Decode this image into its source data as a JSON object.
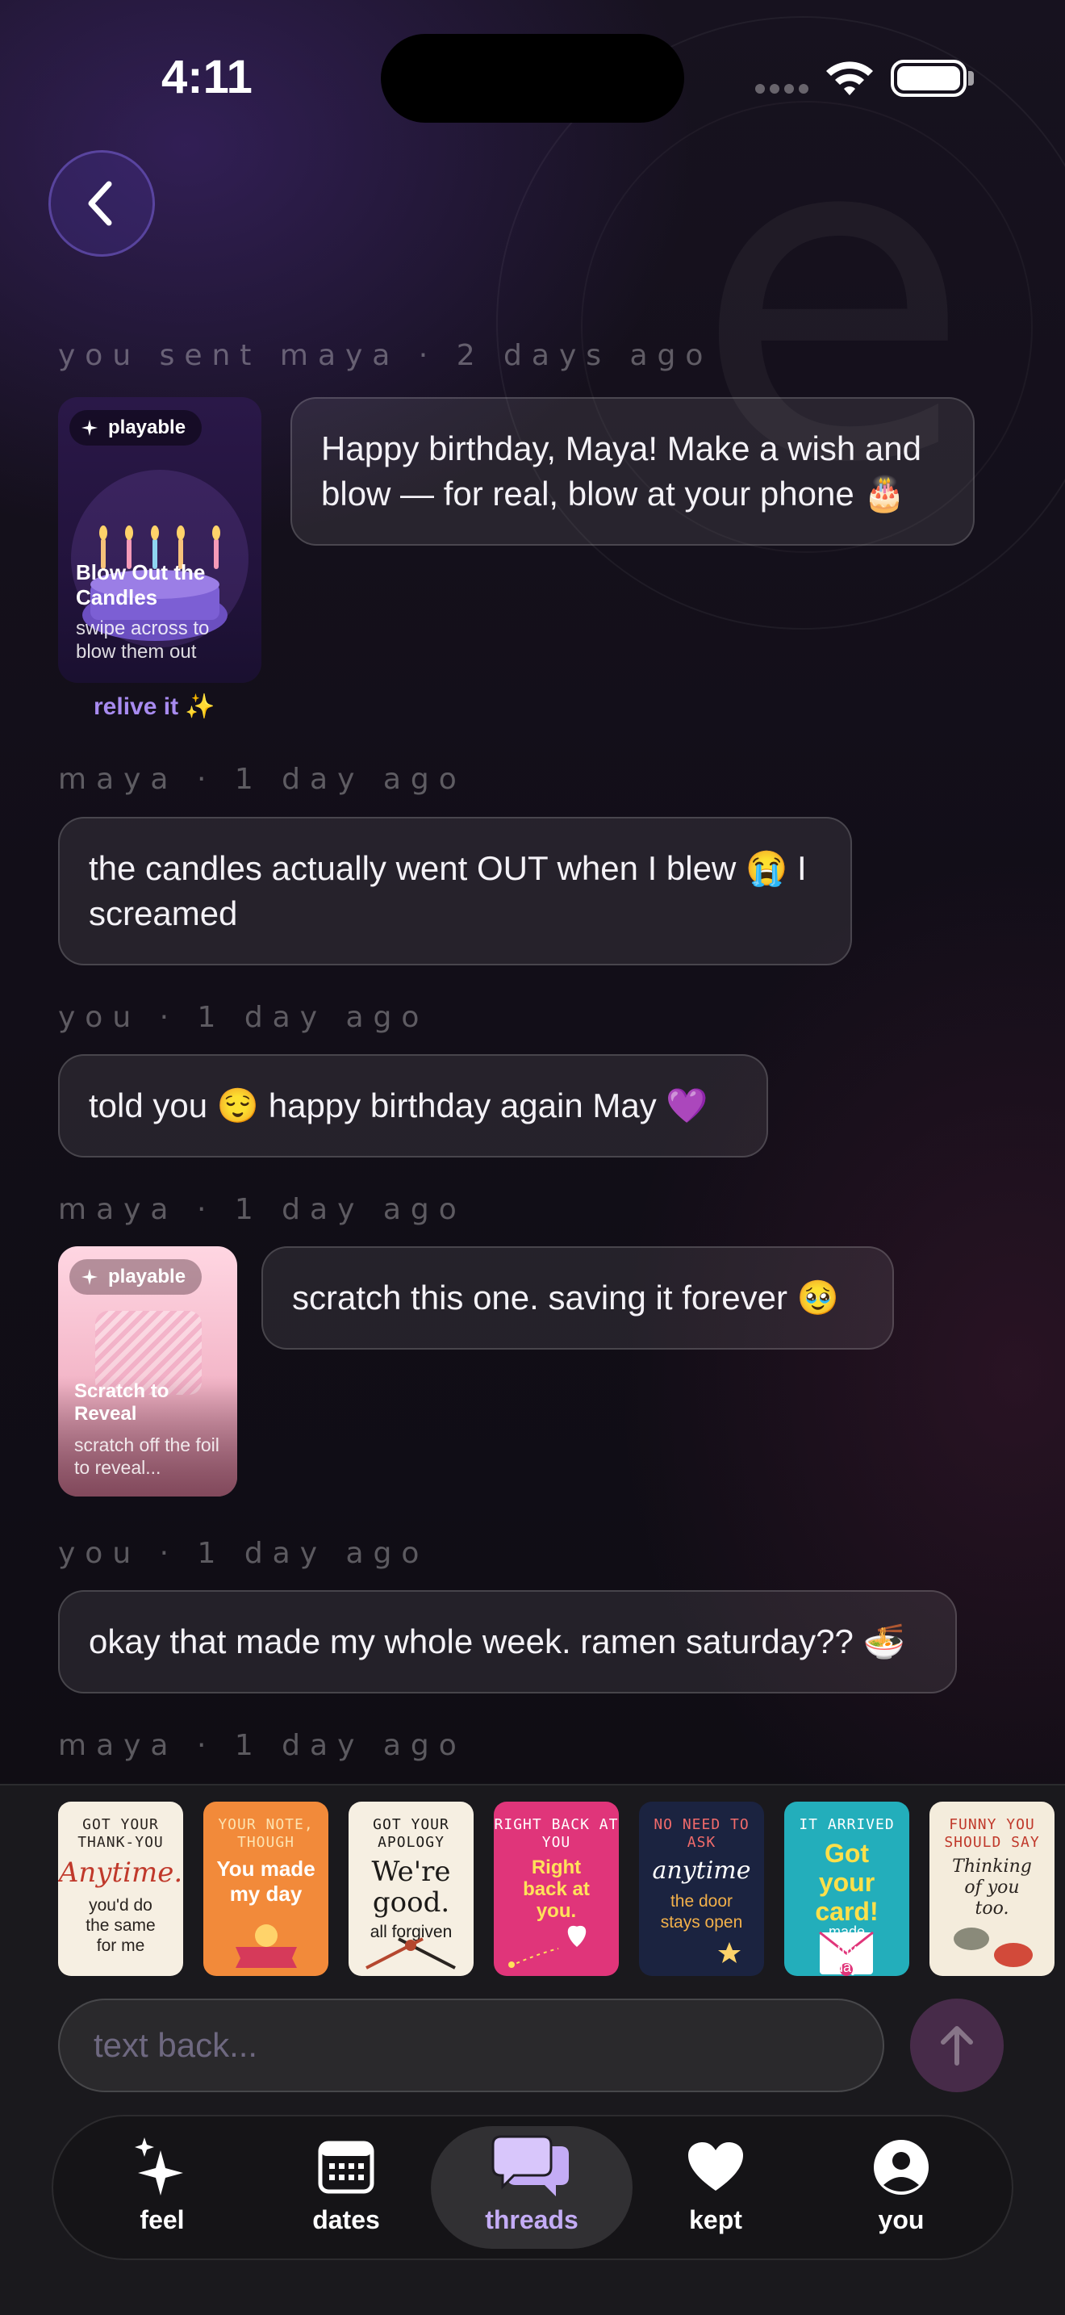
{
  "status": {
    "time": "4:11"
  },
  "thread": {
    "messages": [
      {
        "meta": "you sent maya · 2 days ago",
        "text": "Happy birthday, Maya! Make a wish and blow — for real, blow at your phone 🎂",
        "card": {
          "badge": "playable",
          "title": "Blow Out the Candles",
          "subtitle": "swipe across to blow them out",
          "action": "relive it ✨"
        }
      },
      {
        "meta": "maya · 1 day ago",
        "text": "the candles actually went OUT when I blew 😭 I screamed"
      },
      {
        "meta": "you · 1 day ago",
        "text": "told you 😌 happy birthday again May 💜"
      },
      {
        "meta": "maya · 1 day ago",
        "text": "scratch this one. saving it forever 🥹",
        "card": {
          "badge": "playable",
          "title": "Scratch to Reveal",
          "subtitle": "scratch off the foil to reveal..."
        }
      },
      {
        "meta": "you · 1 day ago",
        "text": "okay that made my whole week. ramen saturday?? 🍜"
      },
      {
        "meta": "maya · 1 day ago"
      }
    ]
  },
  "cards": [
    {
      "top": "GOT YOUR THANK-YOU",
      "main": "Anytime.",
      "sub": "you'd do the same for me",
      "bg": "#f6efe2",
      "fg": "#2a2420",
      "accent": "#c0392b"
    },
    {
      "top": "YOUR NOTE, THOUGH",
      "main": "You made my day",
      "sub": "",
      "bg": "#f28a3a",
      "fg": "#ffffff",
      "accent": "#fde3b0"
    },
    {
      "top": "GOT YOUR APOLOGY",
      "main": "We're good.",
      "sub": "all forgiven",
      "bg": "#f6efe2",
      "fg": "#1c1a18",
      "accent": "#b5472f"
    },
    {
      "top": "RIGHT BACK AT YOU",
      "main": "Right back at you.",
      "sub": "",
      "bg": "#e0357a",
      "fg": "#ffe25a",
      "accent": "#ffffff"
    },
    {
      "top": "NO NEED TO ASK",
      "main": "anytime",
      "sub": "the door stays open",
      "bg": "#1b2340",
      "fg": "#ffffff",
      "accent": "#f2b04a"
    },
    {
      "top": "IT ARRIVED",
      "main": "Got your card!",
      "sub": "made my day",
      "bg": "#23aebb",
      "fg": "#ffe04a",
      "accent": "#ffffff"
    },
    {
      "top": "FUNNY YOU SHOULD SAY",
      "main": "Thinking of you too.",
      "sub": "",
      "bg": "#f4ecdc",
      "fg": "#2a2420",
      "accent": "#c0392b"
    }
  ],
  "composer": {
    "placeholder": "text back..."
  },
  "tabs": [
    {
      "label": "feel",
      "icon": "sparkles-icon"
    },
    {
      "label": "dates",
      "icon": "calendar-icon"
    },
    {
      "label": "threads",
      "icon": "chat-bubbles-icon",
      "active": true
    },
    {
      "label": "kept",
      "icon": "heart-icon"
    },
    {
      "label": "you",
      "icon": "person-icon"
    }
  ],
  "colors": {
    "accent": "#a88bf0",
    "active_tab": "#c4acf6",
    "background": "#0d0b12"
  }
}
